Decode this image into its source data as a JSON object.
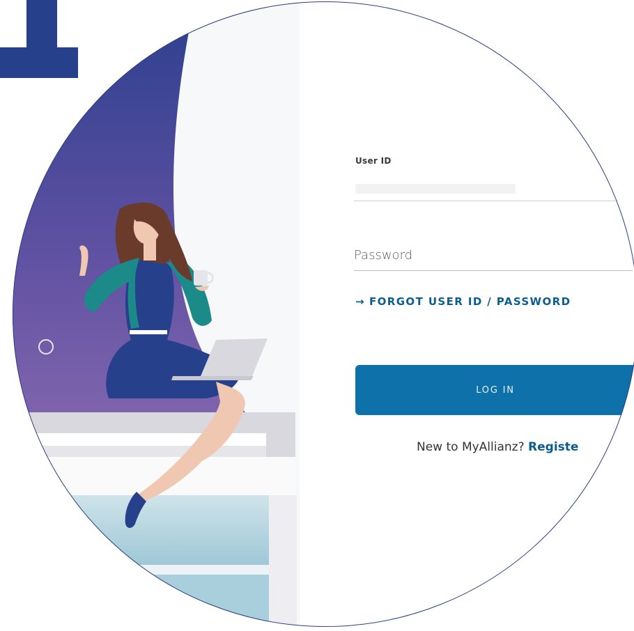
{
  "login_form": {
    "user_id_label": "User ID",
    "user_id_value": "",
    "password_placeholder": "Password",
    "forgot_arrow": "→",
    "forgot_label": "FORGOT USER ID / PASSWORD",
    "login_button_label": "LOG IN",
    "register_prompt": "New to MyAllianz?",
    "register_link": "Registe"
  },
  "colors": {
    "brand_blue": "#0e71aa",
    "link_blue": "#0a5d8c",
    "corner_mark": "#26408b",
    "outline": "#2c3f80"
  },
  "icons": [
    "arrow-right-icon",
    "ring-icon"
  ]
}
